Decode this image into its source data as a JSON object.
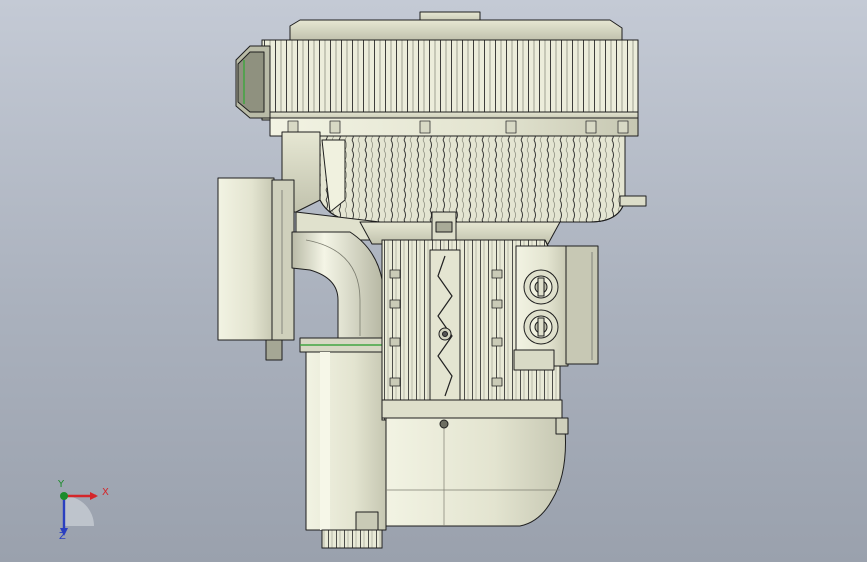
{
  "viewport": {
    "background_top": "#c4cad5",
    "background_bottom": "#9aa1ad",
    "model": "blower-motor-assembly"
  },
  "colors": {
    "part_fill": "#e9ead7",
    "part_shadow": "#c8c9b4",
    "edge": "#1e1e1e",
    "highlight": "#41a541"
  },
  "triad": {
    "x_label": "X",
    "y_label": "Y",
    "z_label": "Z",
    "x_color": "#d4262a",
    "y_color": "#1c8c2c",
    "z_color": "#2a3fc0"
  }
}
